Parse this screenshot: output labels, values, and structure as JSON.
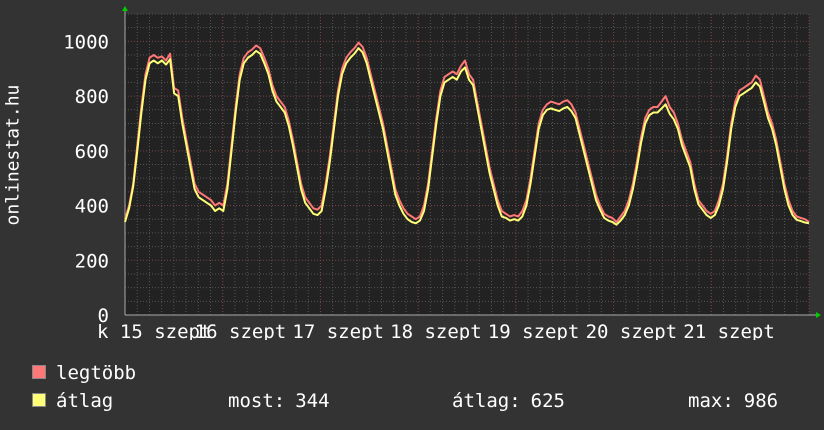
{
  "chart_data": {
    "type": "line",
    "ylabel": "onlinestat.hu",
    "ylim": [
      0,
      1100
    ],
    "yticks": [
      0,
      200,
      400,
      600,
      800,
      1000
    ],
    "x_tick_labels": [
      "k 15 szept",
      "16 szept",
      "17 szept",
      "18 szept",
      "19 szept",
      "20 szept",
      "21 szept"
    ],
    "grid": true,
    "days": 7,
    "series": [
      {
        "name": "legtöbb",
        "color": "#ff7777",
        "values": [
          350,
          400,
          480,
          620,
          760,
          880,
          940,
          950,
          940,
          945,
          930,
          955,
          830,
          820,
          720,
          640,
          560,
          480,
          450,
          440,
          430,
          420,
          400,
          410,
          400,
          480,
          620,
          760,
          880,
          940,
          960,
          970,
          985,
          975,
          940,
          900,
          840,
          800,
          780,
          760,
          710,
          640,
          560,
          480,
          430,
          410,
          390,
          385,
          400,
          480,
          580,
          700,
          820,
          900,
          940,
          960,
          975,
          995,
          980,
          940,
          880,
          820,
          760,
          700,
          620,
          540,
          460,
          420,
          390,
          370,
          360,
          350,
          360,
          400,
          480,
          600,
          720,
          820,
          870,
          880,
          890,
          880,
          910,
          930,
          880,
          860,
          780,
          700,
          620,
          540,
          480,
          420,
          380,
          370,
          360,
          365,
          360,
          380,
          420,
          500,
          600,
          700,
          750,
          770,
          780,
          775,
          770,
          780,
          785,
          770,
          740,
          680,
          620,
          560,
          500,
          440,
          400,
          370,
          360,
          355,
          340,
          360,
          380,
          420,
          480,
          560,
          650,
          720,
          750,
          760,
          760,
          780,
          800,
          760,
          740,
          700,
          640,
          600,
          560,
          480,
          420,
          400,
          380,
          370,
          380,
          420,
          480,
          580,
          700,
          780,
          820,
          830,
          840,
          850,
          875,
          860,
          800,
          740,
          700,
          640,
          560,
          480,
          420,
          380,
          360,
          355,
          350,
          340
        ]
      },
      {
        "name": "átlag",
        "color": "#ffff77",
        "values": [
          340,
          390,
          470,
          600,
          740,
          860,
          920,
          930,
          920,
          930,
          915,
          935,
          810,
          800,
          700,
          620,
          540,
          460,
          430,
          420,
          410,
          400,
          380,
          390,
          380,
          460,
          600,
          740,
          860,
          920,
          940,
          950,
          965,
          955,
          920,
          880,
          820,
          780,
          760,
          740,
          690,
          620,
          540,
          460,
          410,
          390,
          370,
          365,
          380,
          460,
          560,
          680,
          800,
          880,
          920,
          940,
          955,
          975,
          960,
          920,
          860,
          800,
          740,
          680,
          600,
          520,
          440,
          400,
          370,
          350,
          340,
          335,
          345,
          380,
          460,
          580,
          700,
          800,
          850,
          860,
          870,
          860,
          890,
          905,
          860,
          840,
          760,
          680,
          600,
          520,
          460,
          400,
          360,
          355,
          345,
          350,
          345,
          360,
          400,
          480,
          580,
          680,
          730,
          750,
          755,
          750,
          745,
          755,
          760,
          745,
          720,
          660,
          600,
          540,
          480,
          420,
          385,
          355,
          345,
          340,
          330,
          345,
          365,
          400,
          460,
          540,
          630,
          700,
          730,
          740,
          740,
          755,
          770,
          735,
          715,
          680,
          620,
          580,
          540,
          460,
          405,
          385,
          365,
          355,
          365,
          400,
          460,
          560,
          680,
          760,
          800,
          810,
          820,
          830,
          850,
          835,
          780,
          720,
          680,
          620,
          540,
          460,
          400,
          365,
          348,
          343,
          338,
          335
        ]
      }
    ]
  },
  "legend": {
    "max_label": "legtöbb",
    "avg_label": "átlag"
  },
  "stats": {
    "now_label": "most:",
    "now_value": "344",
    "avg_label": "átlag:",
    "avg_value": "625",
    "max_label": "max:",
    "max_value": "986"
  }
}
